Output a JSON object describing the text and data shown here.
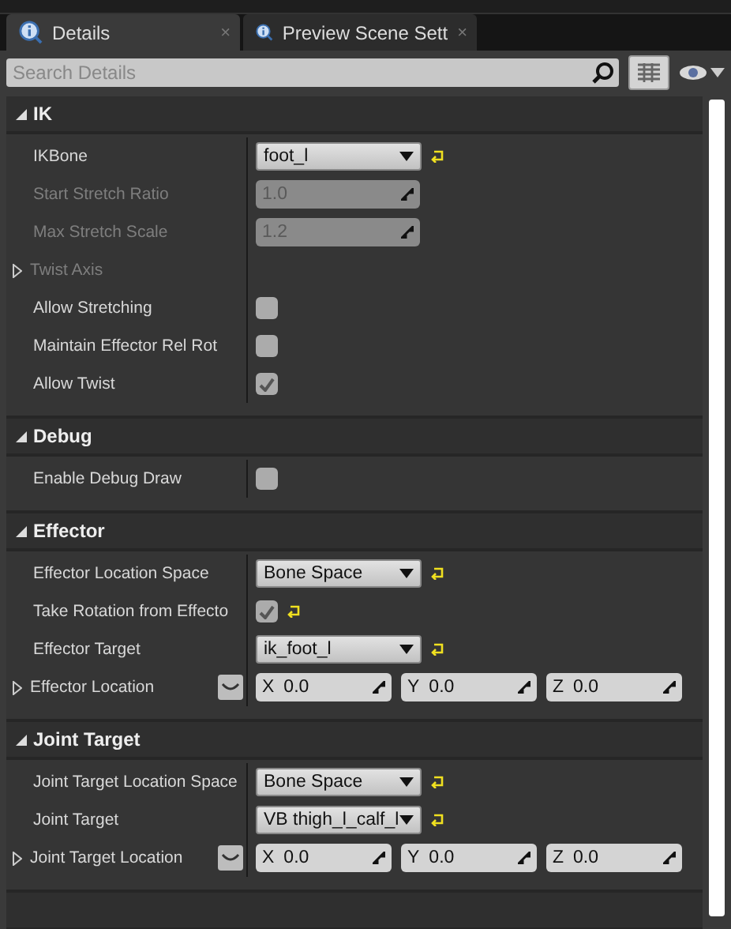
{
  "tabs": [
    {
      "label": "Details",
      "selected": true,
      "close": "×"
    },
    {
      "label": "Preview Scene Sett",
      "selected": false,
      "close": "×"
    }
  ],
  "search": {
    "placeholder": "Search Details"
  },
  "sections": [
    {
      "title": "IK",
      "expanded": true,
      "rows": [
        {
          "kind": "dropdown",
          "label": "IKBone",
          "value": "foot_l",
          "disabled": false,
          "reset": true
        },
        {
          "kind": "number",
          "label": "Start Stretch Ratio",
          "value": "1.0",
          "disabled": true,
          "reset": false
        },
        {
          "kind": "number",
          "label": "Max Stretch Scale",
          "value": "1.2",
          "disabled": true,
          "reset": false
        },
        {
          "kind": "group",
          "label": "Twist Axis",
          "disabled": true,
          "reset": false
        },
        {
          "kind": "checkbox",
          "label": "Allow Stretching",
          "checked": false,
          "disabled": false,
          "reset": false
        },
        {
          "kind": "checkbox",
          "label": "Maintain Effector Rel Rot",
          "checked": false,
          "disabled": false,
          "reset": false
        },
        {
          "kind": "checkbox",
          "label": "Allow Twist",
          "checked": true,
          "disabled": false,
          "reset": false
        }
      ]
    },
    {
      "title": "Debug",
      "expanded": true,
      "rows": [
        {
          "kind": "checkbox",
          "label": "Enable Debug Draw",
          "checked": false,
          "disabled": false,
          "reset": false
        }
      ]
    },
    {
      "title": "Effector",
      "expanded": true,
      "rows": [
        {
          "kind": "dropdown",
          "label": "Effector Location Space",
          "value": "Bone Space",
          "disabled": false,
          "reset": true
        },
        {
          "kind": "checkbox",
          "label": "Take Rotation from Effecto",
          "checked": true,
          "disabled": false,
          "reset": true
        },
        {
          "kind": "dropdown",
          "label": "Effector Target",
          "value": "ik_foot_l",
          "disabled": false,
          "reset": true
        },
        {
          "kind": "vector",
          "label": "Effector Location",
          "disabled": false,
          "reset": false,
          "components": [
            {
              "axis": "X",
              "value": "0.0"
            },
            {
              "axis": "Y",
              "value": "0.0"
            },
            {
              "axis": "Z",
              "value": "0.0"
            }
          ]
        }
      ]
    },
    {
      "title": "Joint Target",
      "expanded": true,
      "rows": [
        {
          "kind": "dropdown",
          "label": "Joint Target Location Space",
          "value": "Bone Space",
          "disabled": false,
          "reset": true
        },
        {
          "kind": "dropdown",
          "label": "Joint Target",
          "value": "VB thigh_l_calf_l",
          "disabled": false,
          "reset": true
        },
        {
          "kind": "vector",
          "label": "Joint Target Location",
          "disabled": false,
          "reset": false,
          "components": [
            {
              "axis": "X",
              "value": "0.0"
            },
            {
              "axis": "Y",
              "value": "0.0"
            },
            {
              "axis": "Z",
              "value": "0.0"
            }
          ]
        }
      ]
    }
  ]
}
